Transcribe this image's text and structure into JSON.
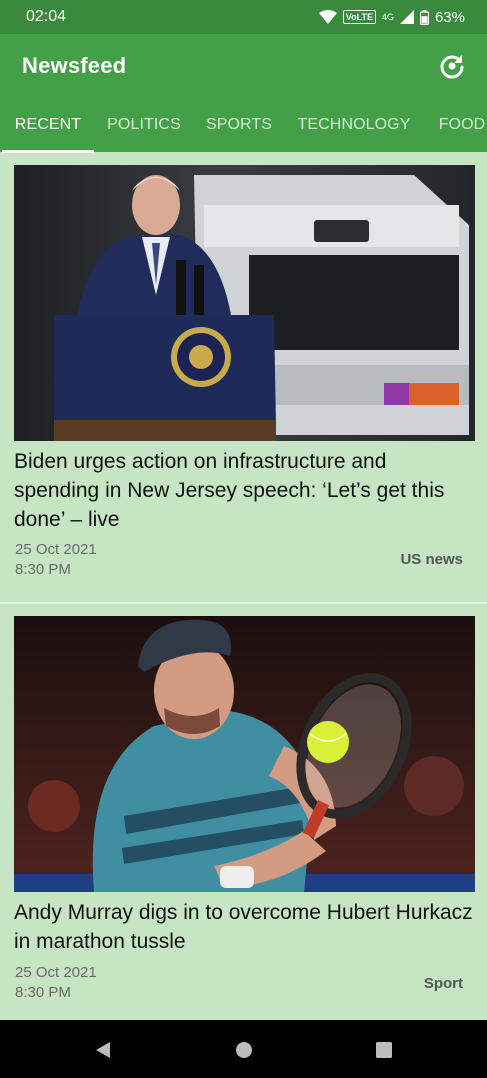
{
  "status_bar": {
    "time": "02:04",
    "volte": "VoLTE",
    "network": "4G",
    "battery": "63%"
  },
  "app_bar": {
    "title": "Newsfeed",
    "refresh_icon": "refresh-icon"
  },
  "tabs": [
    {
      "label": "RECENT",
      "active": true
    },
    {
      "label": "POLITICS",
      "active": false
    },
    {
      "label": "SPORTS",
      "active": false
    },
    {
      "label": "TECHNOLOGY",
      "active": false
    },
    {
      "label": "FOOD",
      "active": false
    }
  ],
  "articles": [
    {
      "title": "Biden urges action on infrastructure and spending in New Jersey speech: ‘Let’s get this done’ – live",
      "date": "25 Oct 2021",
      "time": "8:30 PM",
      "section": "US news"
    },
    {
      "title": "Andy Murray digs in to overcome Hubert Hurkacz in marathon tussle",
      "date": "25 Oct 2021",
      "time": "8:30 PM",
      "section": "Sport"
    }
  ],
  "nav": {
    "back_icon": "back-triangle-icon",
    "home_icon": "home-circle-icon",
    "recents_icon": "recents-square-icon"
  },
  "colors": {
    "status_bar": "#3a8a3e",
    "app_bar": "#43a047",
    "background": "#c6e5c3"
  }
}
